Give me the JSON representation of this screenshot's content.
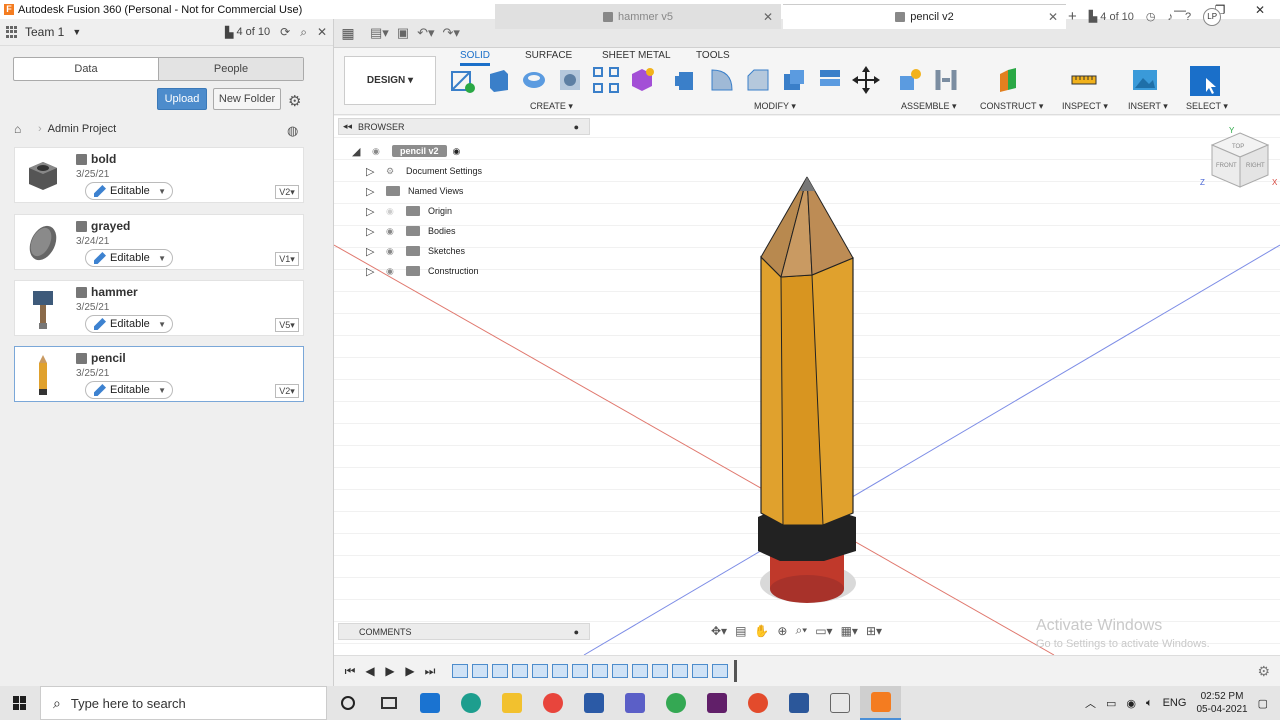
{
  "window": {
    "title": "Autodesk Fusion 360 (Personal - Not for Commercial Use)",
    "controls": [
      "—",
      "❐",
      "✕"
    ]
  },
  "data_panel": {
    "team": "Team 1",
    "counter": "4 of 10",
    "tabs": [
      "Data",
      "People"
    ],
    "upload_label": "Upload",
    "new_folder_label": "New Folder",
    "breadcrumb": "Admin Project",
    "files": [
      {
        "name": "bold",
        "date": "3/25/21",
        "status": "Editable",
        "version": "V2"
      },
      {
        "name": "grayed",
        "date": "3/24/21",
        "status": "Editable",
        "version": "V1"
      },
      {
        "name": "hammer",
        "date": "3/25/21",
        "status": "Editable",
        "version": "V5"
      },
      {
        "name": "pencil",
        "date": "3/25/21",
        "status": "Editable",
        "version": "V2"
      }
    ]
  },
  "tabbar": {
    "tabs": [
      {
        "label": "hammer v5",
        "active": false
      },
      {
        "label": "pencil v2",
        "active": true
      }
    ],
    "counter": "4 of 10",
    "user_initials": "LP"
  },
  "toolbar": {
    "workspace": "DESIGN",
    "workspace_tabs": [
      "SOLID",
      "SURFACE",
      "SHEET METAL",
      "TOOLS"
    ],
    "groups": [
      "CREATE",
      "MODIFY",
      "ASSEMBLE",
      "CONSTRUCT",
      "INSPECT",
      "INSERT",
      "SELECT"
    ]
  },
  "browser": {
    "title": "BROWSER",
    "root": "pencil v2",
    "items": [
      "Document Settings",
      "Named Views",
      "Origin",
      "Bodies",
      "Sketches",
      "Construction"
    ]
  },
  "comments_label": "COMMENTS",
  "watermark": {
    "title": "Activate Windows",
    "subtitle": "Go to Settings to activate Windows."
  },
  "viewcube": {
    "faces": [
      "TOP",
      "FRONT",
      "RIGHT"
    ],
    "axes": [
      "Y",
      "Z",
      "X"
    ]
  },
  "taskbar": {
    "search_placeholder": "Type here to search",
    "language": "ENG",
    "time": "02:52 PM",
    "date": "05-04-2021"
  },
  "colors": {
    "accent": "#1a6fc9",
    "pencil_body": "#e0a12d",
    "pencil_tip": "#c99a62",
    "eraser": "#c0392b"
  }
}
